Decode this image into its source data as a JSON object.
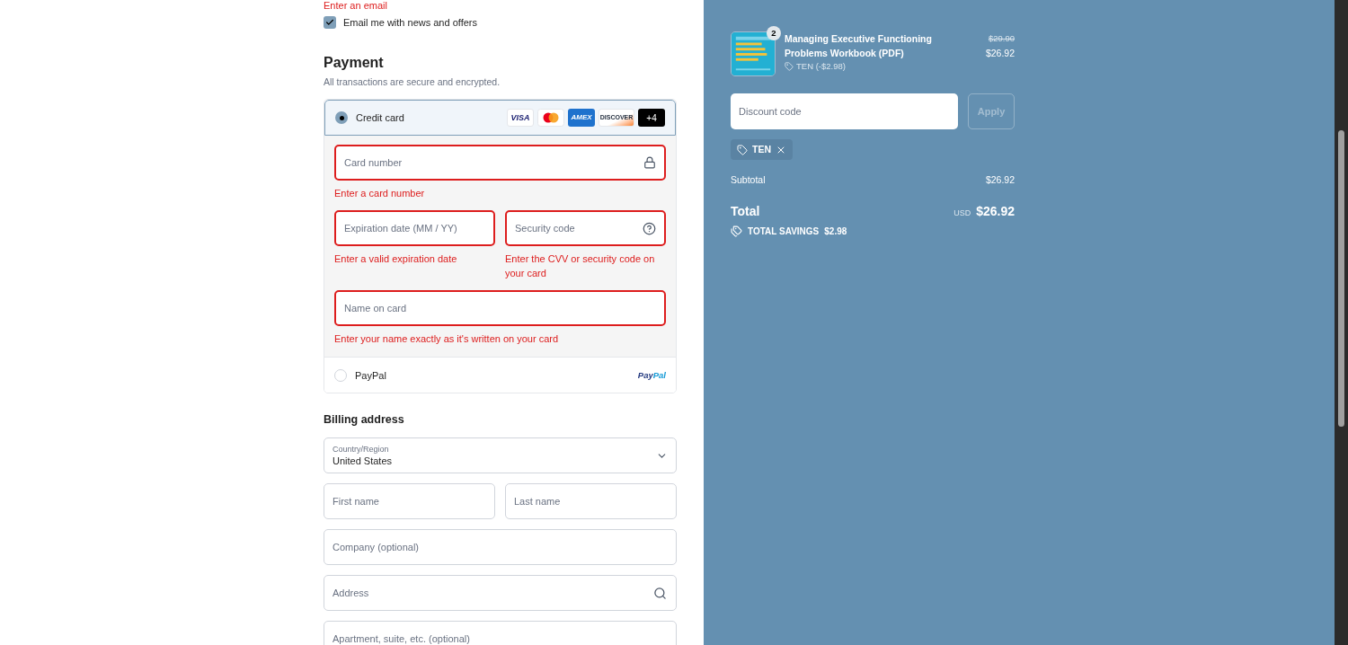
{
  "email_error": "Enter an email",
  "newsletter": {
    "label": "Email me with news and offers",
    "checked": true
  },
  "payment": {
    "title": "Payment",
    "subtitle": "All transactions are secure and encrypted.",
    "methods": [
      {
        "kind": "card",
        "label": "Credit card",
        "selected": true,
        "brands": [
          {
            "kind": "visa",
            "text": "VISA"
          },
          {
            "kind": "mastercard"
          },
          {
            "kind": "amex",
            "text": "AMEX"
          },
          {
            "kind": "discover",
            "text": "DISCOVER"
          },
          {
            "kind": "more",
            "text": "+4"
          }
        ],
        "fields": [
          [
            {
              "kind": "lock",
              "placeholder": "Card number",
              "error": "Enter a card number"
            }
          ],
          [
            {
              "kind": "plain",
              "placeholder": "Expiration date (MM / YY)",
              "error": "Enter a valid expiration date"
            },
            {
              "kind": "help",
              "placeholder": "Security code",
              "error": "Enter the CVV or security code on your card"
            }
          ],
          [
            {
              "kind": "plain",
              "placeholder": "Name on card",
              "error": "Enter your name exactly as it's written on your card"
            }
          ]
        ]
      },
      {
        "kind": "paypal",
        "label": "PayPal",
        "selected": false,
        "logo": [
          "Pay",
          "Pal"
        ]
      }
    ]
  },
  "billing": {
    "title": "Billing address",
    "country": {
      "label": "Country/Region",
      "value": "United States"
    },
    "rows": [
      [
        {
          "kind": "plain",
          "placeholder": "First name"
        },
        {
          "kind": "plain",
          "placeholder": "Last name"
        }
      ],
      [
        {
          "kind": "plain",
          "placeholder": "Company (optional)"
        }
      ],
      [
        {
          "kind": "search",
          "placeholder": "Address"
        }
      ],
      [
        {
          "kind": "plain",
          "placeholder": "Apartment, suite, etc. (optional)"
        }
      ]
    ]
  },
  "summary": {
    "item": {
      "quantity": "2",
      "title": "Managing Executive Functioning Problems Workbook (PDF)",
      "discount": "TEN (-$2.98)",
      "original_price": "$29.90",
      "price": "$26.92"
    },
    "discount_field": {
      "placeholder": "Discount code"
    },
    "apply_button": {
      "label": "Apply",
      "disabled": true
    },
    "applied_code": "TEN",
    "subtotal": {
      "label": "Subtotal",
      "value": "$26.92"
    },
    "total": {
      "label": "Total",
      "currency": "USD",
      "value": "$26.92"
    },
    "savings": {
      "label": "TOTAL SAVINGS",
      "value": "$2.98"
    }
  }
}
